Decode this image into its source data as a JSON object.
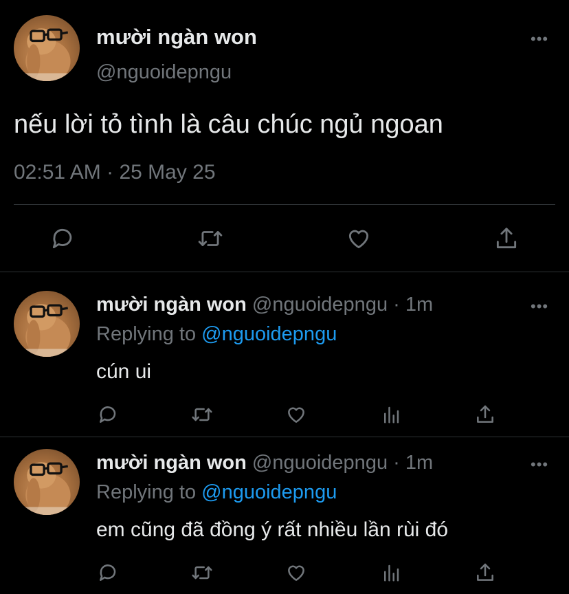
{
  "main_tweet": {
    "display_name": "mười ngàn won",
    "handle": "@nguoidepngu",
    "text": "nếu lời tỏ tình là câu chúc ngủ ngoan",
    "time": "02:51 AM",
    "separator": "·",
    "date": "25 May 25"
  },
  "replies": [
    {
      "display_name": "mười ngàn won",
      "handle": "@nguoidepngu",
      "separator": "·",
      "age": "1m",
      "replying_prefix": "Replying to",
      "replying_to": "@nguoidepngu",
      "text": "cún ui"
    },
    {
      "display_name": "mười ngàn won",
      "handle": "@nguoidepngu",
      "separator": "·",
      "age": "1m",
      "replying_prefix": "Replying to",
      "replying_to": "@nguoidepngu",
      "text": "em cũng đã đồng ý rất nhiều lần rùi đó"
    }
  ],
  "colors": {
    "background": "#000000",
    "text": "#e7e9ea",
    "muted": "#71767b",
    "link": "#1d9bf0",
    "divider": "#2f3336"
  },
  "icons": [
    "reply-icon",
    "retweet-icon",
    "like-icon",
    "share-icon",
    "analytics-icon",
    "more-icon"
  ]
}
